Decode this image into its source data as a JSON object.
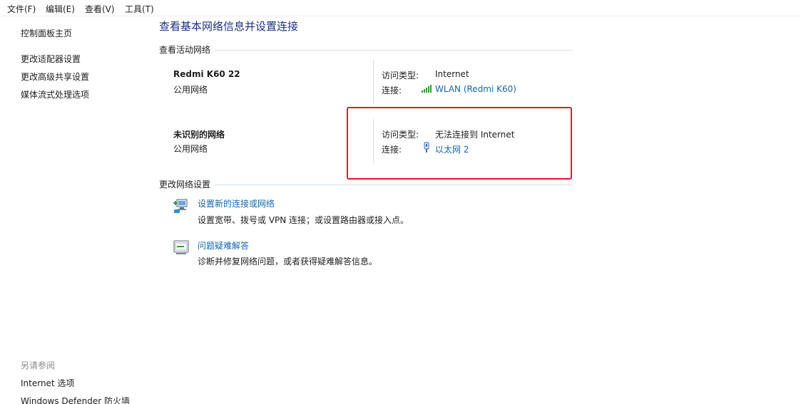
{
  "menu": {
    "file": "文件(F)",
    "edit": "编辑(E)",
    "view": "查看(V)",
    "tools": "工具(T)"
  },
  "sidebar": {
    "home": "控制面板主页",
    "items": [
      "更改适配器设置",
      "更改高级共享设置",
      "媒体流式处理选项"
    ],
    "see_also_title": "另请参阅",
    "see_also": [
      "Internet 选项",
      "Windows Defender 防火墙"
    ]
  },
  "main": {
    "title": "查看基本网络信息并设置连接",
    "active_section": "查看活动网络",
    "networks": [
      {
        "name": "Redmi K60 22",
        "type": "公用网络",
        "access_label": "访问类型:",
        "access_value": "Internet",
        "conn_label": "连接:",
        "conn_value": "WLAN (Redmi K60)",
        "conn_icon": "wifi-signal-icon"
      },
      {
        "name": "未识别的网络",
        "type": "公用网络",
        "access_label": "访问类型:",
        "access_value": "无法连接到 Internet",
        "conn_label": "连接:",
        "conn_value": "以太网 2",
        "conn_icon": "ethernet-icon"
      }
    ],
    "change_section": "更改网络设置",
    "tasks": [
      {
        "link": "设置新的连接或网络",
        "desc": "设置宽带、拨号或 VPN 连接；或设置路由器或接入点。",
        "icon": "new-connection-icon"
      },
      {
        "link": "问题疑难解答",
        "desc": "诊断并修复网络问题，或者获得疑难解答信息。",
        "icon": "troubleshoot-icon"
      }
    ]
  },
  "colors": {
    "title": "#1e3287",
    "link": "#1666b0",
    "highlight": "#e8182a",
    "section_line": "#d5dfe5"
  }
}
